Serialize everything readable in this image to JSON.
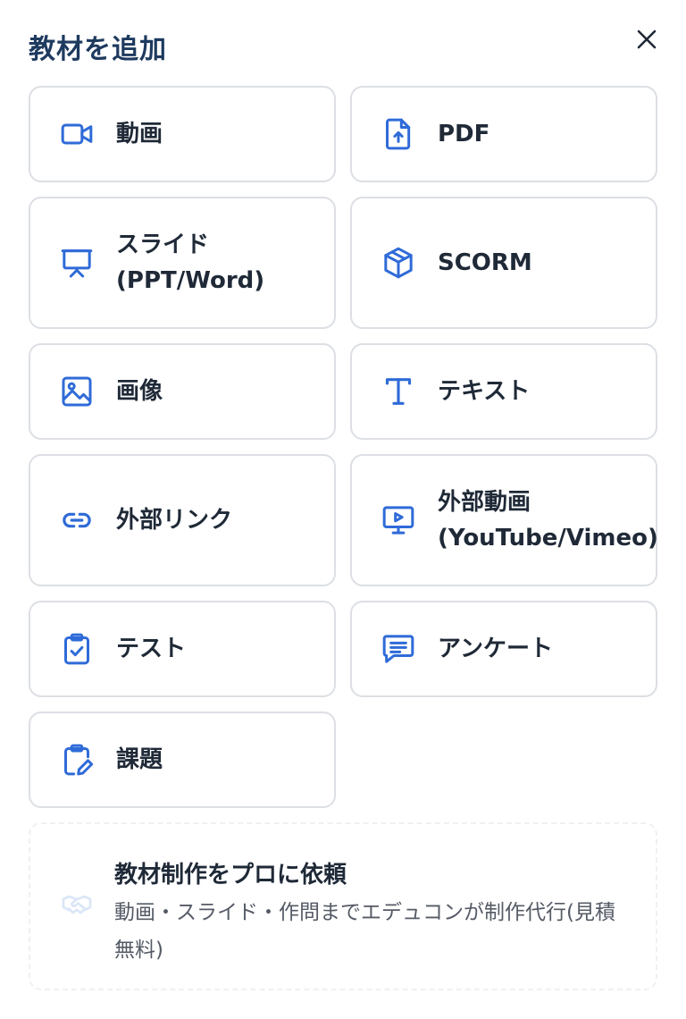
{
  "dialog": {
    "title": "教材を追加"
  },
  "close": {
    "icon": "close-icon"
  },
  "items": {
    "video": {
      "label": "動画",
      "icon": "video-camera-icon"
    },
    "pdf": {
      "label": "PDF",
      "icon": "pdf-upload-icon"
    },
    "slide": {
      "label": "スライド\n(PPT/Word)",
      "icon": "presentation-icon"
    },
    "scorm": {
      "label": "SCORM",
      "icon": "cube-icon"
    },
    "image": {
      "label": "画像",
      "icon": "image-icon"
    },
    "text": {
      "label": "テキスト",
      "icon": "text-t-icon"
    },
    "link": {
      "label": "外部リンク",
      "icon": "link-icon"
    },
    "external_video": {
      "label": "外部動画\n(YouTube/Vimeo)",
      "icon": "monitor-play-icon"
    },
    "test": {
      "label": "テスト",
      "icon": "clipboard-check-icon"
    },
    "survey": {
      "label": "アンケート",
      "icon": "chat-lines-icon"
    },
    "assignment": {
      "label": "課題",
      "icon": "clipboard-pencil-icon"
    }
  },
  "promo": {
    "title": "教材制作をプロに依頼",
    "description": "動画・スライド・作問までエデュコンが制作代行(見積無料)",
    "icon": "handshake-icon"
  },
  "colors": {
    "accent": "#2f6bd8",
    "title": "#1e3a5f",
    "border": "#dcdfe4"
  }
}
